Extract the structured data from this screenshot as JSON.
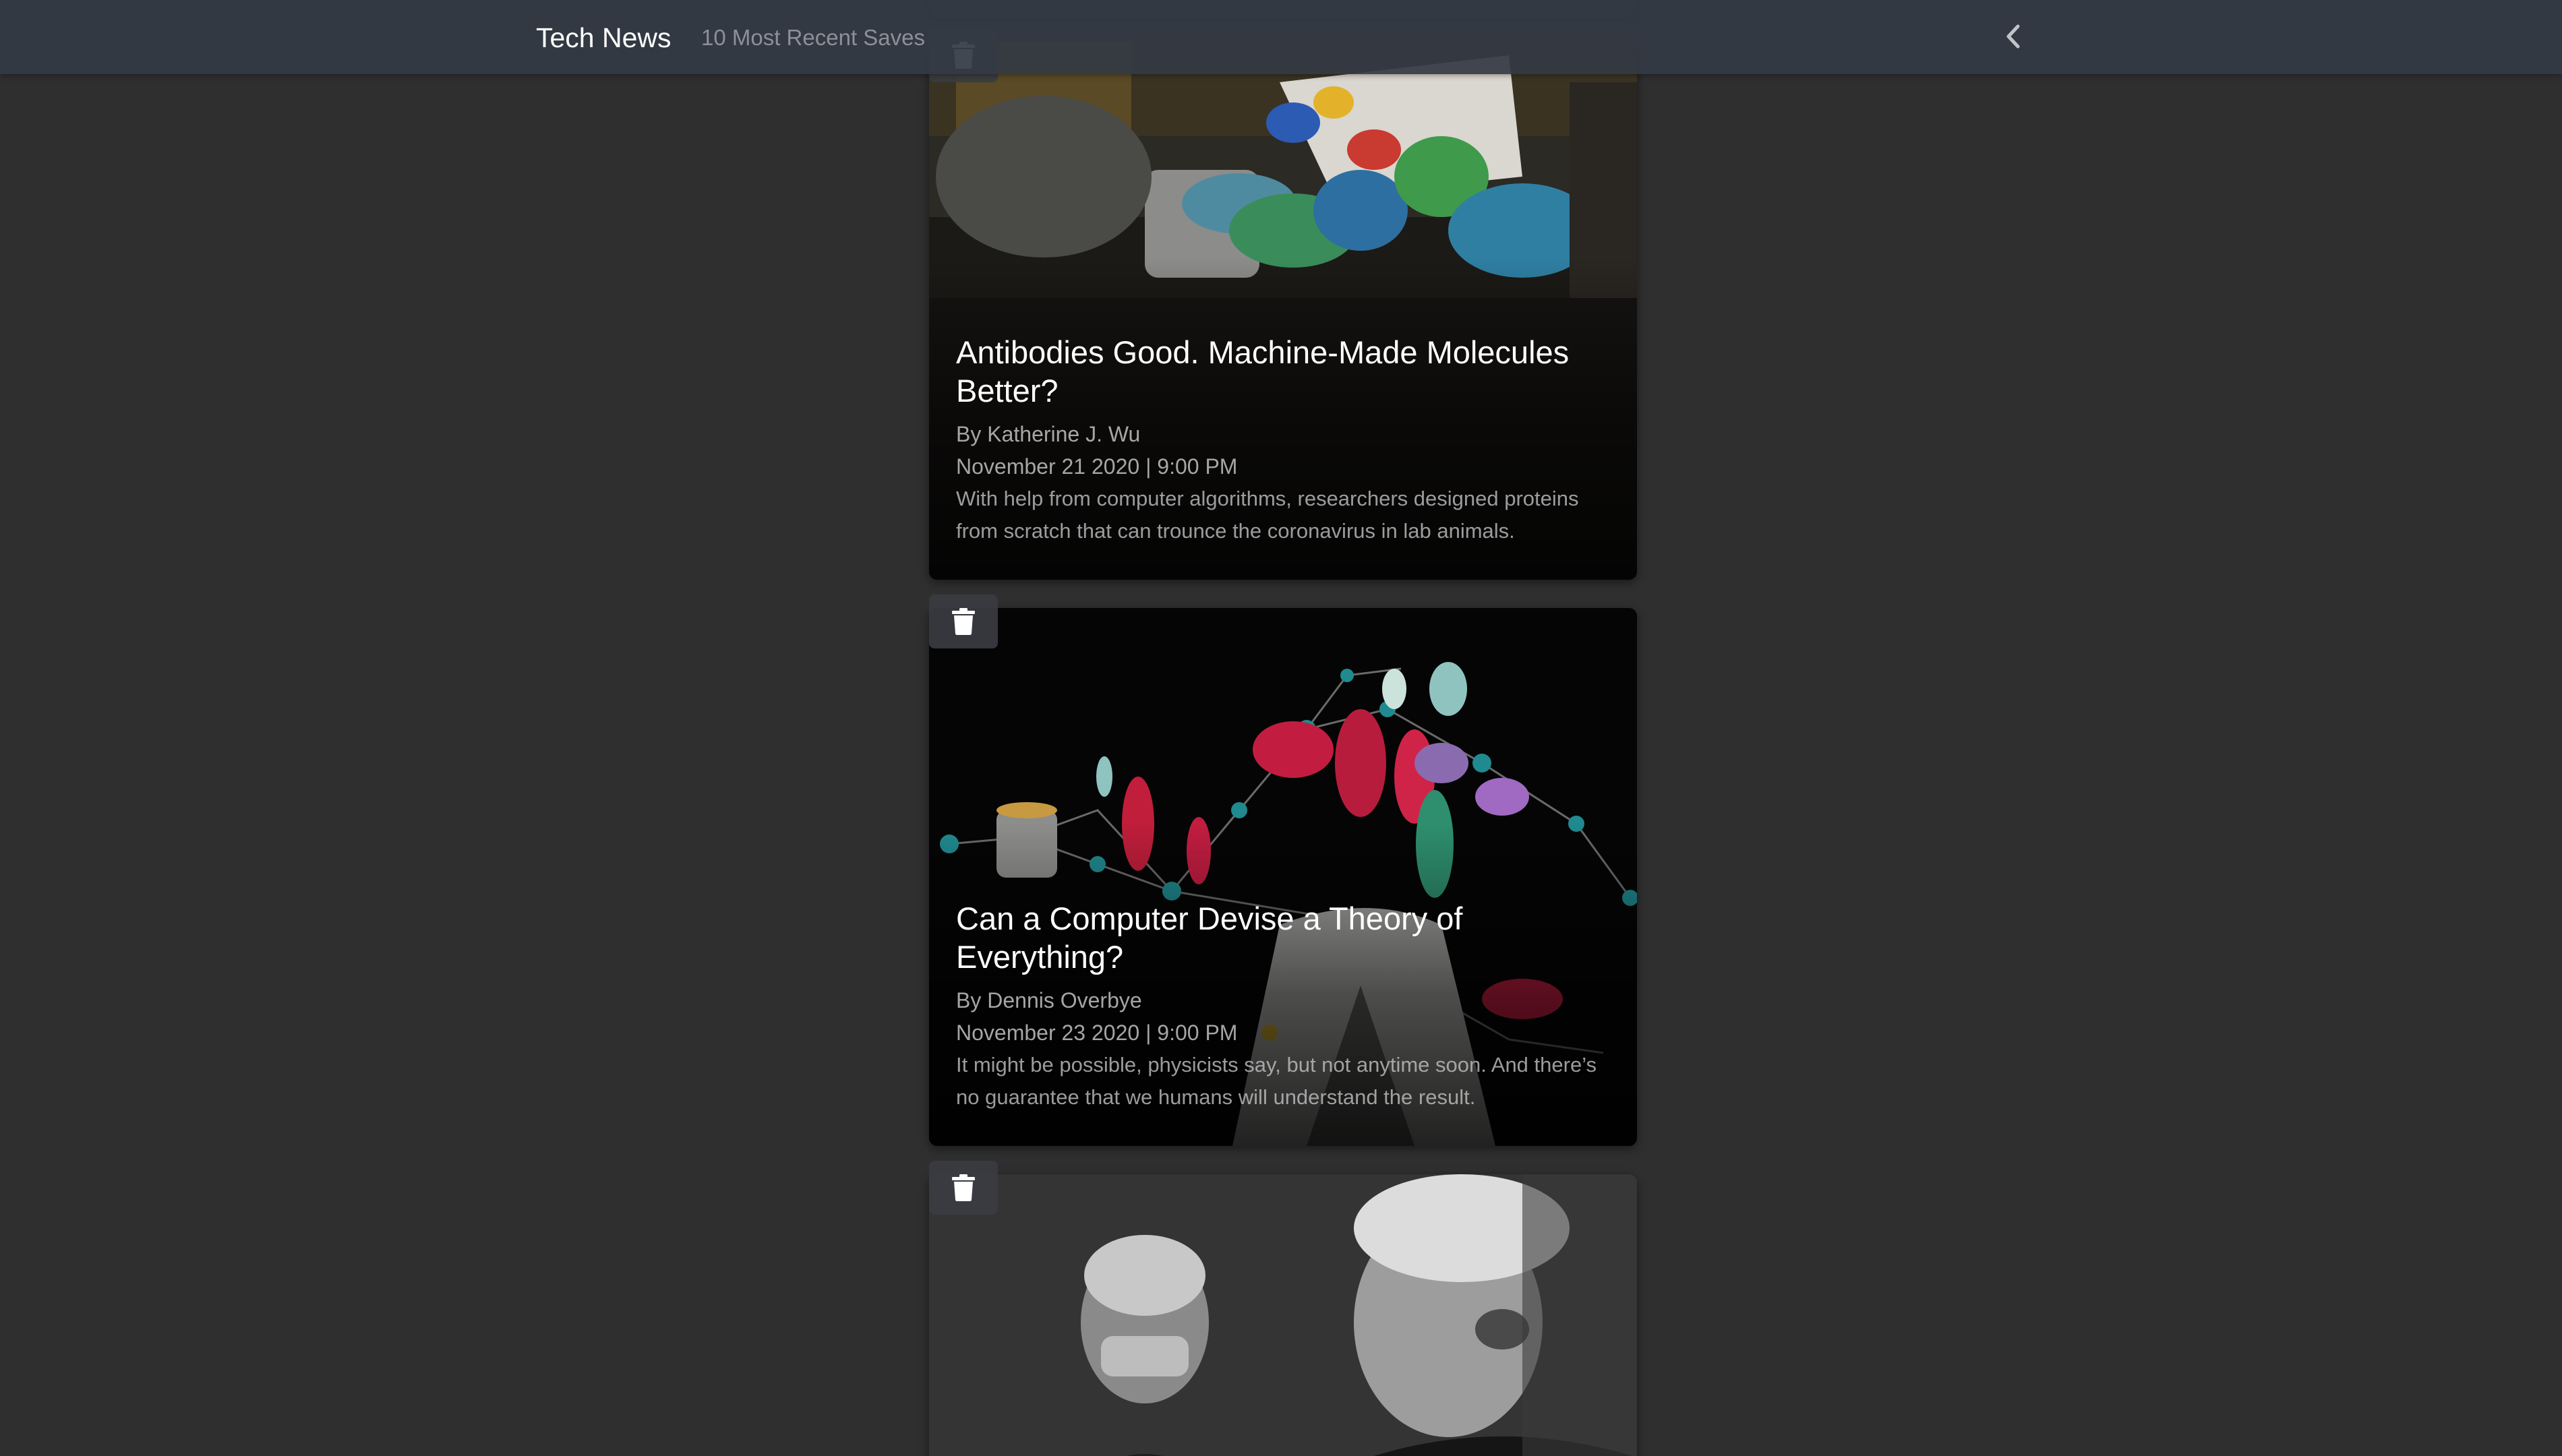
{
  "header": {
    "brand": "Tech News",
    "subtitle": "10 Most Recent Saves",
    "back_icon": "chevron-left-icon"
  },
  "articles": [
    {
      "title": "Antibodies Good. Machine-Made Molecules Better?",
      "author": "By Katherine J. Wu",
      "date": "November 21 2020 | 9:00 PM",
      "description": "With help from computer algorithms, researchers designed proteins from scratch that can trounce the coronavirus in lab animals.",
      "delete_icon": "trash-icon"
    },
    {
      "title": "Can a Computer Devise a Theory of Everything?",
      "author": "By Dennis Overbye",
      "date": "November 23 2020 | 9:00 PM",
      "description": "It might be possible, physicists say, but not anytime soon. And there’s no guarantee that we humans will understand the result.",
      "delete_icon": "trash-icon"
    },
    {
      "title": "",
      "author": "",
      "date": "",
      "description": "",
      "delete_icon": "trash-icon"
    }
  ],
  "colors": {
    "page_background": "#2f2f30",
    "navbar_background": "#343a44",
    "title_text": "#ffffff",
    "meta_text": "#c2c2c2"
  }
}
